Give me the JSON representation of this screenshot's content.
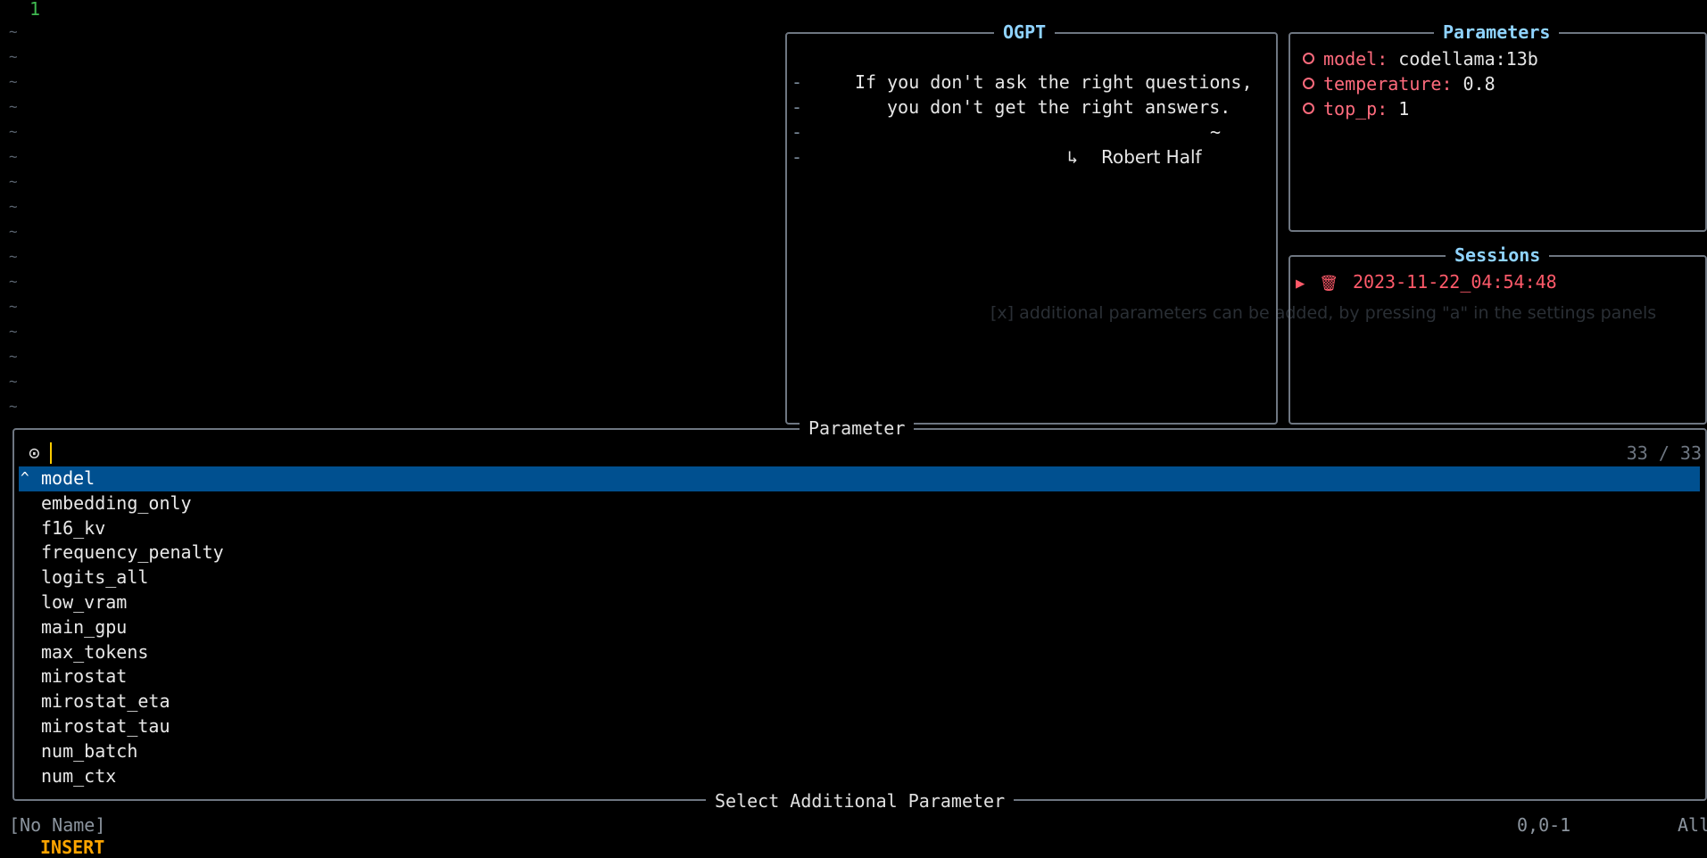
{
  "editor": {
    "line_number": "1",
    "tilde": "~"
  },
  "ogpt": {
    "title": "OGPT",
    "quote_line1": "If you don't ask the right questions,",
    "quote_line2": "you don't get the right answers.",
    "dash": "-",
    "quote_tilde": "~",
    "arrow": "↳",
    "author": "Robert Half"
  },
  "parameters": {
    "title": "Parameters",
    "items": [
      {
        "key": "model:",
        "value": "codellama:13b"
      },
      {
        "key": "temperature:",
        "value": "0.8"
      },
      {
        "key": "top_p:",
        "value": "1"
      }
    ]
  },
  "sessions": {
    "title": "Sessions",
    "items": [
      {
        "marker": "▶",
        "icon": "🗑",
        "label": "2023-11-22_04:54:48"
      }
    ]
  },
  "background_hint": "[x] additional parameters can be added, by pressing \"a\" in the settings panels",
  "picker": {
    "title": "Parameter",
    "footer": "Select Additional Parameter",
    "prompt_icon": "⊙",
    "query": "",
    "count": "33 / 33",
    "selected_marker": "^",
    "items": [
      "model",
      "embedding_only",
      "f16_kv",
      "frequency_penalty",
      "logits_all",
      "low_vram",
      "main_gpu",
      "max_tokens",
      "mirostat",
      "mirostat_eta",
      "mirostat_tau",
      "num_batch",
      "num_ctx"
    ]
  },
  "statusline": {
    "filename": "[No Name]",
    "position": "0,0-1",
    "scroll": "All",
    "mode": "INSERT"
  },
  "colors": {
    "accent_title": "#8fd3ff",
    "key_red": "#ff6b7d",
    "selection_bg": "#005090",
    "border": "#6e7681"
  }
}
